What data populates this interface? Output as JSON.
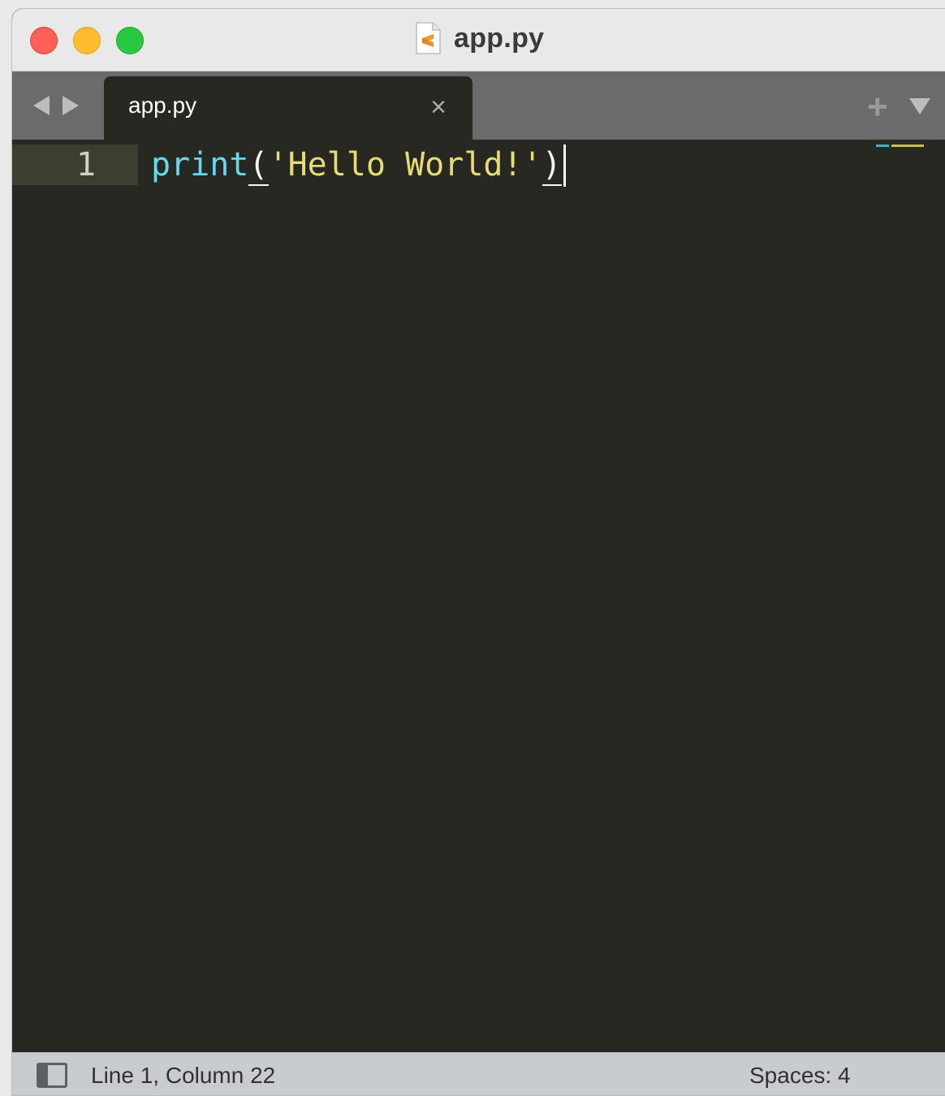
{
  "window": {
    "title": "app.py",
    "title_icon": "sublime-file-icon"
  },
  "tabs": [
    {
      "label": "app.py",
      "active": true,
      "close_glyph": "×"
    }
  ],
  "tabbar": {
    "back_icon": "arrow-left-icon",
    "forward_icon": "arrow-right-icon",
    "new_tab_glyph": "+",
    "menu_icon": "triangle-down-icon"
  },
  "editor": {
    "lines": [
      {
        "number": "1",
        "tokens": {
          "fn": "print",
          "open_paren": "(",
          "string": "'Hello World!'",
          "close_paren": ")"
        }
      }
    ],
    "colors": {
      "background": "#272822",
      "function": "#66d9ef",
      "string": "#e6db74",
      "punctuation": "#f8f8f2",
      "line_highlight": "#3e3d32"
    }
  },
  "statusbar": {
    "position": "Line 1, Column 22",
    "indentation": "Spaces: 4",
    "panel_icon": "sidebar-toggle-icon"
  }
}
